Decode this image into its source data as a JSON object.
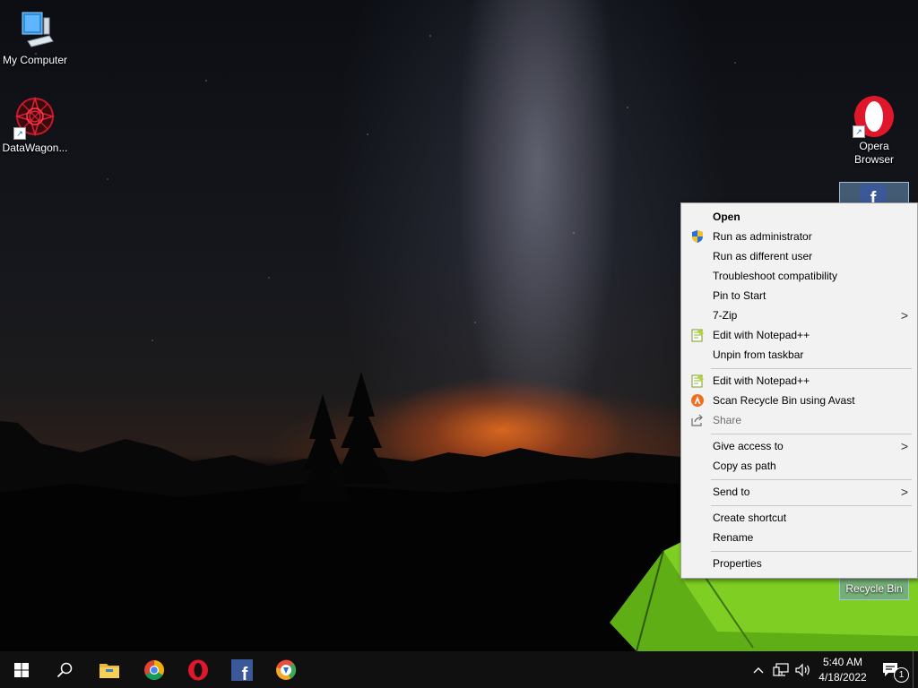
{
  "desktop_icons": {
    "my_computer": "My Computer",
    "datawagon": "DataWagon...",
    "opera_line1": "Opera",
    "opera_line2": "Browser",
    "recycle_bin": "Recycle Bin"
  },
  "context_menu": {
    "open": "Open",
    "run_as_admin": "Run as administrator",
    "run_as_different_user": "Run as different user",
    "troubleshoot": "Troubleshoot compatibility",
    "pin_to_start": "Pin to Start",
    "seven_zip": "7-Zip",
    "edit_notepadpp_1": "Edit with Notepad++",
    "unpin_taskbar": "Unpin from taskbar",
    "edit_notepadpp_2": "Edit with Notepad++",
    "scan_avast": "Scan Recycle Bin using Avast",
    "share": "Share",
    "give_access": "Give access to",
    "copy_as_path": "Copy as path",
    "send_to": "Send to",
    "create_shortcut": "Create shortcut",
    "rename": "Rename",
    "properties": "Properties"
  },
  "taskbar": {
    "time": "5:40 AM",
    "date": "4/18/2022",
    "notification_count": "1",
    "pinned_icons": [
      "windows-start-icon",
      "search-icon",
      "file-explorer-icon",
      "chrome-icon",
      "opera-icon",
      "facebook-icon",
      "avast-browser-icon"
    ]
  },
  "colors": {
    "menu_background": "#f2f2f2",
    "taskbar": "#101010",
    "opera_red": "#e0162b",
    "facebook_blue": "#3b5998"
  }
}
